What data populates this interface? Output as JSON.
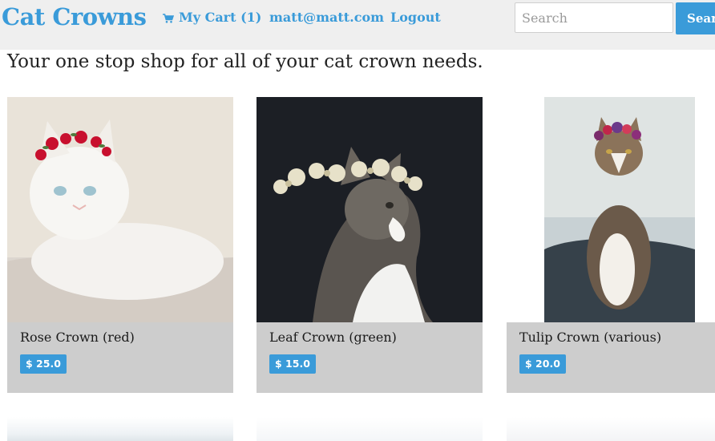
{
  "navbar": {
    "brand": "Cat Crowns",
    "cart_label": "My Cart (1)",
    "cart_icon": "shopping-cart-icon",
    "email": "matt@matt.com",
    "logout": "Logout",
    "search_placeholder": "Search",
    "search_button": "Search"
  },
  "tagline": "Your one stop shop for all of your cat crown needs.",
  "products": [
    {
      "name": "Rose Crown (red)",
      "price": "$ 25.0"
    },
    {
      "name": "Leaf Crown (green)",
      "price": "$ 15.0"
    },
    {
      "name": "Tulip Crown (various)",
      "price": "$ 20.0"
    }
  ],
  "colors": {
    "accent": "#3a9bd9",
    "navbar_bg": "#efefef",
    "card_bg": "#cdcdcd"
  }
}
